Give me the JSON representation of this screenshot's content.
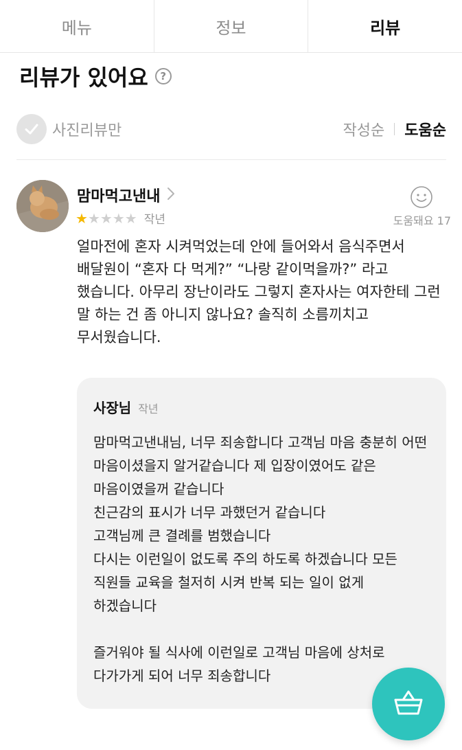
{
  "tabs": [
    {
      "label": "메뉴",
      "active": false
    },
    {
      "label": "정보",
      "active": false
    },
    {
      "label": "리뷰",
      "active": true
    }
  ],
  "section": {
    "title": "리뷰가 있어요",
    "help_icon": "question-circle-icon"
  },
  "filters": {
    "photo_only_label": "사진리뷰만",
    "sort_by_date": "작성순",
    "sort_by_helpful": "도움순",
    "active_sort": "도움순"
  },
  "review": {
    "username": "맘마먹고낸내",
    "rating": 1,
    "max_rating": 5,
    "date": "작년",
    "helpful_label": "도움돼요 17",
    "helpful_count": 17,
    "body": "얼마전에 혼자 시켜먹었는데 안에 들어와서 음식주면서 배달원이 “혼자 다 먹게?” “나랑 같이먹을까?” 라고 했습니다. 아무리 장난이라도 그렇지 혼자사는 여자한테 그런 말 하는 건 좀 아니지 않나요? 솔직히 소름끼치고 무서웠습니다."
  },
  "reply": {
    "name": "사장님",
    "date": "작년",
    "body": "맘마먹고낸내님, 너무 죄송합니다 고객님 마음 충분히 어떤 마음이셨을지 알거같습니다 제 입장이였어도 같은 마음이였을꺼 같습니다\n친근감의 표시가 너무 과했던거 같습니다\n고객님께 큰 결례를 범했습니다\n다시는 이런일이 없도록 주의 하도록 하겠습니다 모든 직원들 교육을 철저히 시켜 반복 되는 일이 없게 하겠습니다\n\n즐거워야 될 식사에 이런일로 고객님 마음에 상처로 다가가게 되어 너무 죄송합니다"
  },
  "colors": {
    "accent": "#2ec4bd",
    "star": "#f5b800",
    "muted": "#999999"
  }
}
